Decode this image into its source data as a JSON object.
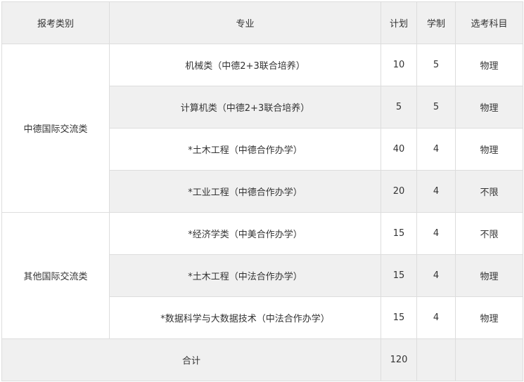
{
  "headers": {
    "category": "报考类别",
    "major": "专业",
    "plan": "计划",
    "duration": "学制",
    "subject": "选考科目"
  },
  "groups": [
    {
      "category": "中德国际交流类",
      "rows": [
        {
          "major": "机械类（中德2+3联合培养）",
          "plan": "10",
          "duration": "5",
          "subject": "物理"
        },
        {
          "major": "计算机类（中德2+3联合培养）",
          "plan": "5",
          "duration": "5",
          "subject": "物理"
        },
        {
          "major": "*土木工程（中德合作办学）",
          "plan": "40",
          "duration": "4",
          "subject": "物理"
        },
        {
          "major": "*工业工程（中德合作办学）",
          "plan": "20",
          "duration": "4",
          "subject": "不限"
        }
      ]
    },
    {
      "category": "其他国际交流类",
      "rows": [
        {
          "major": "*经济学类（中美合作办学）",
          "plan": "15",
          "duration": "4",
          "subject": "不限"
        },
        {
          "major": "*土木工程（中法合作办学）",
          "plan": "15",
          "duration": "4",
          "subject": "物理"
        },
        {
          "major": "*数据科学与大数据技术（中法合作办学）",
          "plan": "15",
          "duration": "4",
          "subject": "物理"
        }
      ]
    }
  ],
  "total": {
    "label": "合计",
    "plan": "120"
  }
}
